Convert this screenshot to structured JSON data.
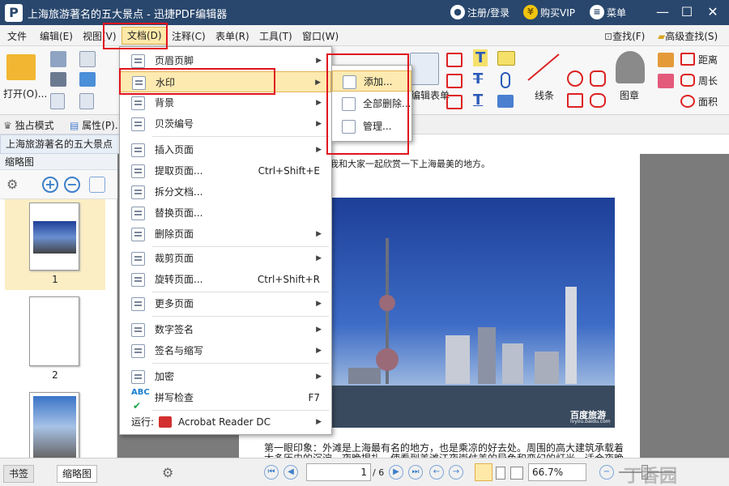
{
  "window": {
    "title": "上海旅游著名的五大景点 - 迅捷PDF编辑器",
    "login_label": "注册/登录",
    "vip_label": "购买VIP",
    "menu_label": "菜单",
    "vip_icon_glyph": "¥",
    "min_glyph": "—",
    "max_glyph": "☐",
    "close_glyph": "✕"
  },
  "menubar": {
    "items": [
      "文件",
      "编辑(E)",
      "视图(V)",
      "文档(D)",
      "注释(C)",
      "表单(R)",
      "工具(T)",
      "窗口(W)"
    ],
    "right_items": [
      "查找(F)",
      "高级查找(S)"
    ]
  },
  "ribbon": {
    "open_label": "打开(O)...",
    "form_label": "编辑表单",
    "line_label": "线条",
    "stamp_label": "图章",
    "distance_label": "距离",
    "perimeter_label": "周长",
    "area_label": "面积",
    "text_glyph": "T"
  },
  "subbar": {
    "exclusive_label": "独占模式",
    "properties_label": "属性(P)..."
  },
  "doc_tab": {
    "title": "上海旅游著名的五大景点",
    "close_glyph": "×"
  },
  "left_panel": {
    "header": "缩略图",
    "thumbnails": [
      {
        "number": "1",
        "selected": true
      },
      {
        "number": "2",
        "selected": false
      }
    ]
  },
  "document": {
    "first_line": "我和大家一起欣赏一下上海最美的地方。",
    "photo_watermark": "百度旅游",
    "photo_watermark_sub": "lvyou.baidu.com",
    "para_line1": "第一眼印象：外滩是上海最有名的地方，也是乘凉的好去处。周围的高大建筑承载着",
    "para_line2": "太多历史的沉淀，夜晚揭扎，使看到美滩江夜崇仗美的异色和变幻的灯光，适合夜晚"
  },
  "doc_menu": {
    "items": [
      {
        "label": "页眉页脚",
        "shortcut": "",
        "submenu": true
      },
      {
        "label": "水印",
        "shortcut": "",
        "submenu": true,
        "highlighted": true
      },
      {
        "label": "背景",
        "shortcut": "",
        "submenu": true
      },
      {
        "label": "贝茨编号",
        "shortcut": "",
        "submenu": true
      },
      {
        "label": "插入页面",
        "shortcut": "",
        "submenu": true
      },
      {
        "label": "提取页面...",
        "shortcut": "Ctrl+Shift+E",
        "submenu": false
      },
      {
        "label": "拆分文档...",
        "shortcut": "",
        "submenu": false
      },
      {
        "label": "替换页面...",
        "shortcut": "",
        "submenu": false
      },
      {
        "label": "删除页面",
        "shortcut": "",
        "submenu": true
      },
      {
        "label": "裁剪页面",
        "shortcut": "",
        "submenu": true
      },
      {
        "label": "旋转页面...",
        "shortcut": "Ctrl+Shift+R",
        "submenu": false
      },
      {
        "label": "更多页面",
        "shortcut": "",
        "submenu": true
      },
      {
        "label": "数字签名",
        "shortcut": "",
        "submenu": true
      },
      {
        "label": "签名与缩写",
        "shortcut": "",
        "submenu": true
      },
      {
        "label": "加密",
        "shortcut": "",
        "submenu": true
      },
      {
        "label": "拼写检查",
        "shortcut": "F7",
        "submenu": false
      },
      {
        "label": "运行:",
        "shortcut": "",
        "submenu": true,
        "extra": "Acrobat Reader DC"
      }
    ],
    "spell_icon_text": "ABC"
  },
  "watermark_submenu": {
    "items": [
      {
        "label": "添加...",
        "highlighted": true
      },
      {
        "label": "全部删除..."
      },
      {
        "label": "管理..."
      }
    ]
  },
  "bottom": {
    "tabs": [
      "书签",
      "缩略图"
    ],
    "page_input": "1",
    "page_total": "/ 6",
    "zoom": "66.7%",
    "site_watermark": "丁香园"
  },
  "colors": {
    "titlebar": "#29476d",
    "highlight": "#fdeab0",
    "annotation_red": "#e0141e",
    "accent_blue": "#3c7fc9"
  }
}
